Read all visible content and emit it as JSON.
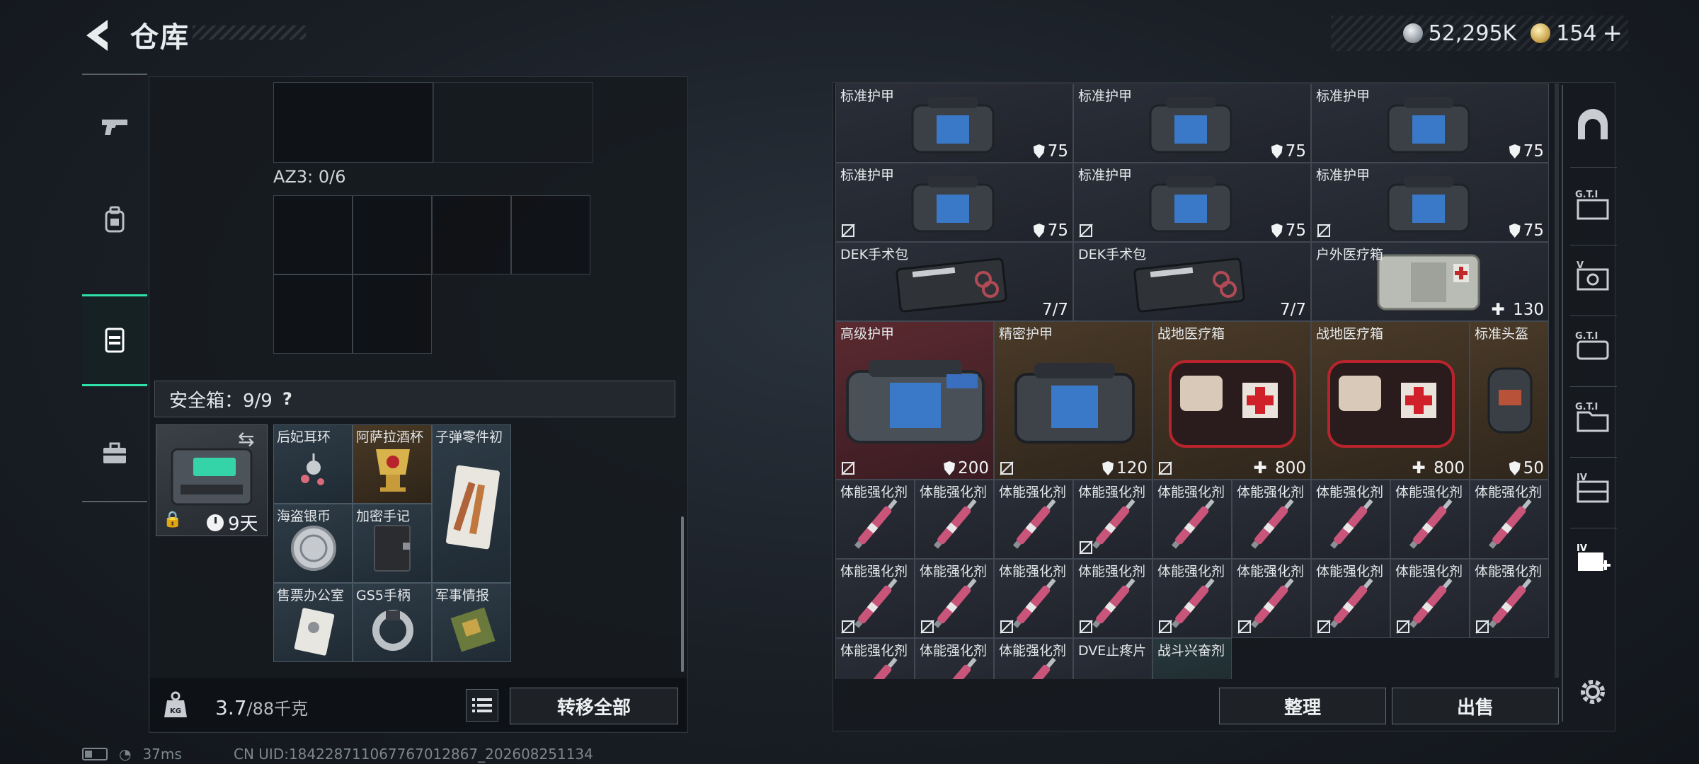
{
  "header": {
    "title": "仓库",
    "silver_amount": "52,295K",
    "gold_amount": "154",
    "gold_add": "+"
  },
  "left_panel": {
    "az3_label": "AZ3: 0/6",
    "safebox_label": "安全箱：9/9",
    "help": "?",
    "safebox_days": "9天",
    "weight_value": "3.7",
    "weight_cap": "/88千克",
    "kg_icon_text": "KG",
    "transfer_all": "转移全部",
    "safe_items": [
      {
        "name": "后妃耳环"
      },
      {
        "name": "阿萨拉酒杯"
      },
      {
        "name": "子弹零件初"
      },
      {
        "name": "海盗银币"
      },
      {
        "name": "加密手记"
      },
      {
        "name": "售票办公室"
      },
      {
        "name": "GS5手柄"
      },
      {
        "name": "军事情报"
      }
    ]
  },
  "inventory": {
    "items": [
      {
        "name": "标准护甲",
        "value": "75"
      },
      {
        "name": "标准护甲",
        "value": "75"
      },
      {
        "name": "标准护甲",
        "value": "75"
      },
      {
        "name": "标准护甲",
        "value": "75"
      },
      {
        "name": "标准护甲",
        "value": "75"
      },
      {
        "name": "标准护甲",
        "value": "75"
      },
      {
        "name": "DEK手术包",
        "value": "7/7"
      },
      {
        "name": "DEK手术包",
        "value": "7/7"
      },
      {
        "name": "户外医疗箱",
        "value": "130"
      },
      {
        "name": "高级护甲",
        "value": "200"
      },
      {
        "name": "精密护甲",
        "value": "120"
      },
      {
        "name": "战地医疗箱",
        "value": "800"
      },
      {
        "name": "战地医疗箱",
        "value": "800"
      },
      {
        "name": "标准头盔",
        "value": "50"
      },
      {
        "name": "体能强化剂"
      },
      {
        "name": "DVE止疼片"
      },
      {
        "name": "战斗兴奋剂"
      }
    ],
    "sort_label": "整理",
    "sell_label": "出售"
  },
  "rail": {
    "labels": [
      "G.T.I",
      "V",
      "G.T.I",
      "G.T.I",
      "IV",
      "IV"
    ]
  },
  "status": {
    "ping": "37ms",
    "uid": "CN UID:184228711067767012867_202608251134"
  },
  "colors": {
    "accent": "#2fe0a8",
    "red_tier": "#5a2a30",
    "gold_tier": "#4a3a28",
    "blue_tier": "#2b2f39"
  }
}
